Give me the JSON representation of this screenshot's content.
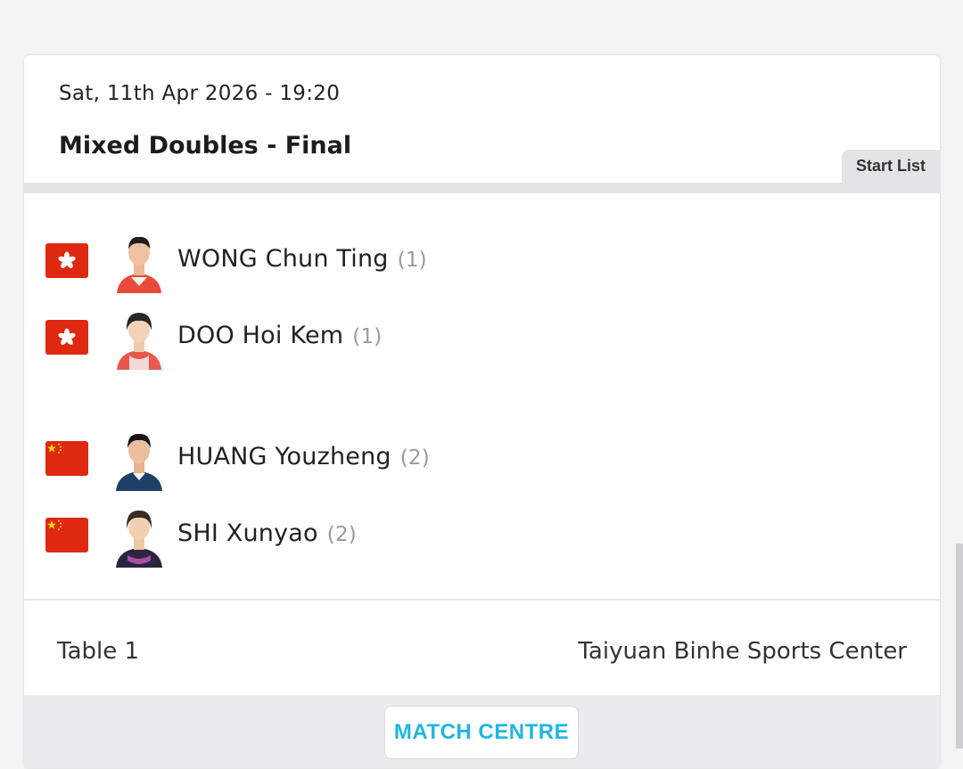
{
  "match": {
    "datetime": "Sat, 11th Apr 2026 - 19:20",
    "title": "Mixed Doubles - Final",
    "tab_label": "Start List",
    "table": "Table 1",
    "venue": "Taiyuan Binhe Sports Center",
    "match_centre_label": "MATCH CENTRE"
  },
  "teams": [
    {
      "country": "Hong Kong, China",
      "flag_icon": "hong-kong-flag-icon",
      "players": [
        {
          "name": "WONG Chun Ting",
          "seed": "(1)"
        },
        {
          "name": "DOO Hoi Kem",
          "seed": "(1)"
        }
      ]
    },
    {
      "country": "China",
      "flag_icon": "china-flag-icon",
      "players": [
        {
          "name": "HUANG Youzheng",
          "seed": "(2)"
        },
        {
          "name": "SHI Xunyao",
          "seed": "(2)"
        }
      ]
    }
  ],
  "colors": {
    "accent": "#1fb6e3",
    "flag_red": "#de2910",
    "flag_star": "#ffde00"
  }
}
